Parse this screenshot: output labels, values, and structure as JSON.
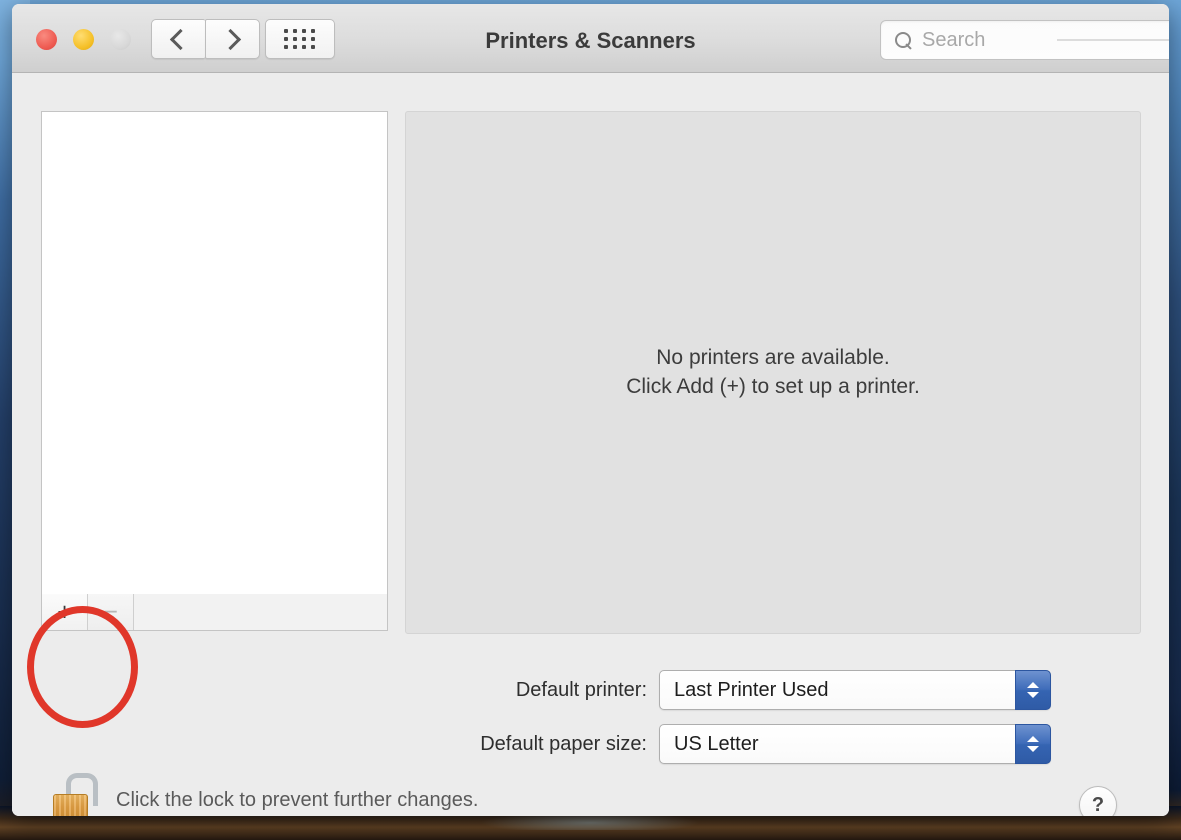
{
  "window": {
    "title": "Printers & Scanners",
    "traffic_lights": [
      {
        "name": "close",
        "color": "#ee5b52"
      },
      {
        "name": "minimize",
        "color": "#f5c028"
      },
      {
        "name": "zoom",
        "color": "#d8d8d8"
      }
    ],
    "nav": {
      "back_icon": "chevron-left-icon",
      "forward_icon": "chevron-right-icon",
      "showall_icon": "grid-dots-icon"
    },
    "search": {
      "placeholder": "Search",
      "value": "",
      "icon": "search-icon"
    }
  },
  "main": {
    "printer_list": {
      "items": []
    },
    "list_toolbar": {
      "add_label": "+",
      "remove_label": "−",
      "add_enabled": true,
      "remove_enabled": false
    },
    "detail": {
      "empty_line1": "No printers are available.",
      "empty_line2": "Click Add (+) to set up a printer."
    },
    "settings": [
      {
        "label": "Default printer:",
        "value": "Last Printer Used"
      },
      {
        "label": "Default paper size:",
        "value": "US Letter"
      }
    ]
  },
  "footer": {
    "lock_icon": "lock-open-icon",
    "lock_text": "Click the lock to prevent further changes.",
    "help_label": "?"
  },
  "annotation": {
    "shape": "ellipse",
    "color": "#e0372a",
    "targets": "add-printer-button"
  }
}
